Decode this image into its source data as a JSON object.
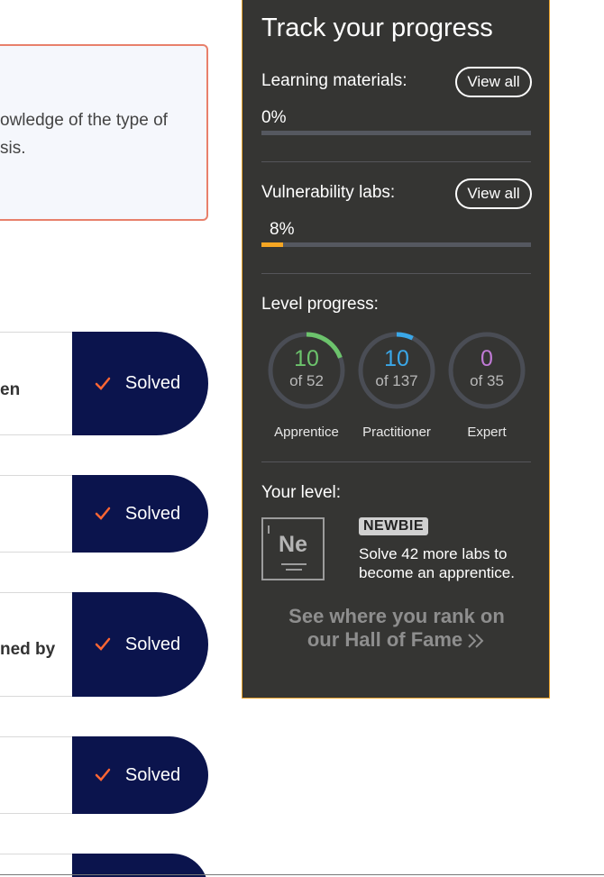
{
  "info_box": {
    "text": "owledge of the type of\nsis."
  },
  "labs": [
    {
      "title": "en",
      "status": "Solved"
    },
    {
      "title": "",
      "status": "Solved"
    },
    {
      "title": "ned by",
      "status": "Solved"
    },
    {
      "title": "",
      "status": "Solved"
    }
  ],
  "progress": {
    "title": "Track your progress",
    "learning": {
      "label": "Learning materials:",
      "view_all": "View all",
      "percent_text": "0%",
      "fraction": 0
    },
    "labs": {
      "label": "Vulnerability labs:",
      "view_all": "View all",
      "percent_text": "8%",
      "fraction": 0.08
    },
    "level_progress": {
      "label": "Level progress:",
      "rings": [
        {
          "value": "10",
          "of": "of 52",
          "name": "Apprentice",
          "color": "#6cc36c",
          "fraction": 0.192
        },
        {
          "value": "10",
          "of": "of 137",
          "name": "Practitioner",
          "color": "#3aa7e8",
          "fraction": 0.073
        },
        {
          "value": "0",
          "of": "of 35",
          "name": "Expert",
          "color": "#c07ad6",
          "fraction": 0
        }
      ]
    },
    "your_level": {
      "label": "Your level:",
      "badge_symbol": "Ne",
      "tag": "NEWBIE",
      "description": "Solve 42 more labs to become an apprentice."
    },
    "hall_of_fame": "See where you rank on our Hall of Fame"
  },
  "colors": {
    "solved_bg": "#0b144d",
    "check": "#ff6633",
    "sidebar_bg": "#353533",
    "lab_bar": "#f5a623"
  }
}
